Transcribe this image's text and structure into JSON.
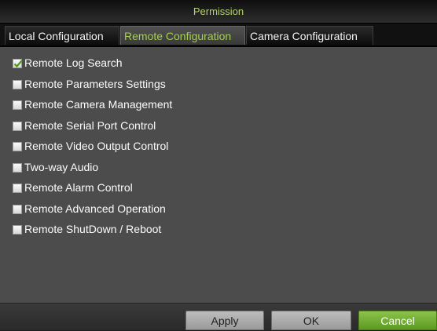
{
  "dialog": {
    "title": "Permission"
  },
  "tabs": [
    {
      "label": "Local Configuration",
      "active": false
    },
    {
      "label": "Remote Configuration",
      "active": true
    },
    {
      "label": "Camera Configuration",
      "active": false
    }
  ],
  "permissions": [
    {
      "label": "Remote Log Search",
      "checked": true
    },
    {
      "label": "Remote Parameters Settings",
      "checked": false
    },
    {
      "label": "Remote Camera Management",
      "checked": false
    },
    {
      "label": "Remote Serial Port Control",
      "checked": false
    },
    {
      "label": "Remote Video Output Control",
      "checked": false
    },
    {
      "label": "Two-way Audio",
      "checked": false
    },
    {
      "label": "Remote Alarm Control",
      "checked": false
    },
    {
      "label": "Remote Advanced Operation",
      "checked": false
    },
    {
      "label": "Remote ShutDown / Reboot",
      "checked": false
    }
  ],
  "buttons": {
    "apply": "Apply",
    "ok": "OK",
    "cancel": "Cancel"
  },
  "colors": {
    "title_text": "#b6d36b",
    "active_tab_text": "#a7cf53",
    "checkmark": "#4e9a1c",
    "primary_button": "#6fae2e"
  }
}
